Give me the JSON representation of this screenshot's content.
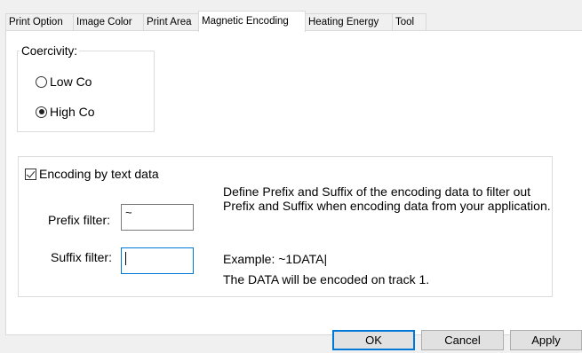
{
  "tabs": [
    {
      "label": "Print Option",
      "active": false
    },
    {
      "label": "Image Color",
      "active": false
    },
    {
      "label": "Print Area",
      "active": false
    },
    {
      "label": "Magnetic Encoding",
      "active": true
    },
    {
      "label": "Heating Energy",
      "active": false
    },
    {
      "label": "Tool",
      "active": false
    }
  ],
  "coercivity": {
    "title": "Coercivity:",
    "options": [
      {
        "label": "Low Co",
        "checked": false
      },
      {
        "label": "High Co",
        "checked": true
      }
    ]
  },
  "encoding": {
    "checkbox_label": "Encoding by text data",
    "checked": true,
    "prefix_label": "Prefix filter:",
    "prefix_value": "~",
    "suffix_label": "Suffix filter:",
    "suffix_value": "",
    "description": "Define Prefix and Suffix of the encoding data to filter out Prefix and Suffix when encoding data from your application.",
    "example": "Example: ~1DATA|",
    "note": "The DATA will be encoded on track 1."
  },
  "buttons": {
    "ok": "OK",
    "cancel": "Cancel",
    "apply": "Apply"
  },
  "colors": {
    "focus_accent": "#0078d7",
    "panel_bg": "#ffffff",
    "window_bg": "#f0f0f0"
  }
}
